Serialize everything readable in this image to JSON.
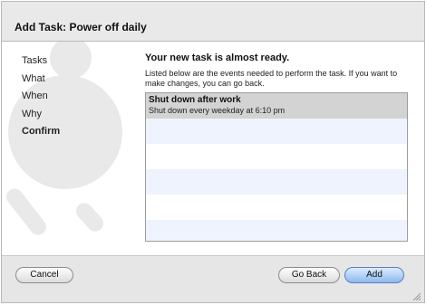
{
  "window": {
    "title": "Add Task: Power off daily"
  },
  "sidebar": {
    "items": [
      {
        "label": "Tasks",
        "active": false
      },
      {
        "label": "What",
        "active": false
      },
      {
        "label": "When",
        "active": false
      },
      {
        "label": "Why",
        "active": false
      },
      {
        "label": "Confirm",
        "active": true
      }
    ]
  },
  "main": {
    "heading": "Your new task is almost ready.",
    "description": "Listed below are the events needed to perform the task. If you want to make changes, you can go back.",
    "events": [
      {
        "title": "Shut down after work",
        "subtitle": "Shut down every weekday at 6:10 pm"
      }
    ]
  },
  "footer": {
    "cancel_label": "Cancel",
    "back_label": "Go Back",
    "add_label": "Add"
  },
  "colors": {
    "selected_row": "#d3d3d3",
    "stripe_row": "#eef3fd",
    "default_button": "#8db9ee",
    "art": "#e9e9e9"
  }
}
